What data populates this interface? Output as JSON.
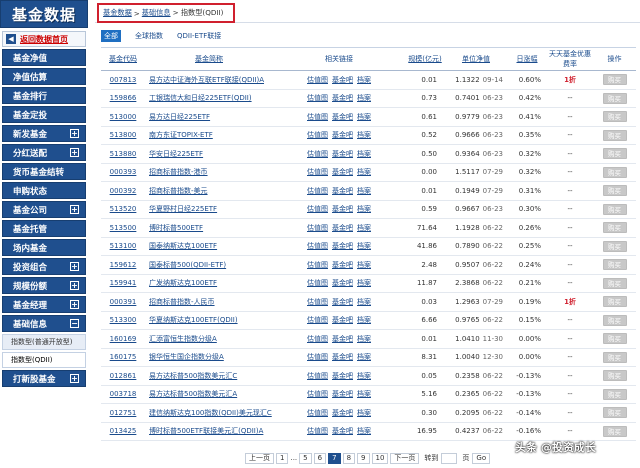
{
  "sidebar": {
    "logo": "基金数据",
    "back_home": "返回数据首页",
    "items": [
      {
        "label": "基金净值",
        "pm": ""
      },
      {
        "label": "净值估算",
        "pm": ""
      },
      {
        "label": "基金排行",
        "pm": ""
      },
      {
        "label": "基金定投",
        "pm": ""
      },
      {
        "label": "新发基金",
        "pm": "+"
      },
      {
        "label": "分红送配",
        "pm": "+"
      },
      {
        "label": "货币基金结转",
        "pm": ""
      },
      {
        "label": "申购状态",
        "pm": ""
      },
      {
        "label": "基金公司",
        "pm": "+"
      },
      {
        "label": "基金托管",
        "pm": ""
      },
      {
        "label": "场内基金",
        "pm": ""
      },
      {
        "label": "投资组合",
        "pm": "+"
      },
      {
        "label": "规模份额",
        "pm": "+"
      },
      {
        "label": "基金经理",
        "pm": "+"
      },
      {
        "label": "基础信息",
        "pm": "−"
      }
    ],
    "sub_items": [
      "指数型(普通开放型)",
      "指数型(QDII)"
    ],
    "last_item": {
      "label": "打新股基金",
      "pm": "+"
    }
  },
  "breadcrumb": {
    "link1": "基金数据",
    "sep": ">",
    "link2": "基础信息",
    "current": "> 指数型(QDII)"
  },
  "filter_tabs": [
    "全部",
    "全球指数",
    "QDII-ETF联接"
  ],
  "table": {
    "headers": [
      "基金代码",
      "基金简称",
      "相关链接",
      "规模(亿元)",
      "单位净值",
      "日涨幅",
      "天天基金优惠费率",
      "操作"
    ],
    "link_labels": [
      "估值图",
      "基金吧",
      "档案"
    ],
    "buy_label": "购买",
    "rows": [
      {
        "code": "007813",
        "name": "易方达中证海外互联ETF联接(QDII)A",
        "scale": "0.01",
        "nav": "1.1322",
        "date": "09-14",
        "change": "0.60%",
        "discount": "1折"
      },
      {
        "code": "159866",
        "name": "工银瑞信大和日经225ETF(QDII)",
        "scale": "0.73",
        "nav": "0.7401",
        "date": "06-23",
        "change": "0.42%",
        "discount": "--"
      },
      {
        "code": "513000",
        "name": "易方达日经225ETF",
        "scale": "0.61",
        "nav": "0.9779",
        "date": "06-23",
        "change": "0.41%",
        "discount": "--"
      },
      {
        "code": "513800",
        "name": "南方东证TOPIX-ETF",
        "scale": "0.52",
        "nav": "0.9666",
        "date": "06-23",
        "change": "0.35%",
        "discount": "--"
      },
      {
        "code": "513880",
        "name": "华安日经225ETF",
        "scale": "0.50",
        "nav": "0.9364",
        "date": "06-23",
        "change": "0.32%",
        "discount": "--"
      },
      {
        "code": "000393",
        "name": "招商标普指数-港币",
        "scale": "0.00",
        "nav": "1.5117",
        "date": "07-29",
        "change": "0.32%",
        "discount": "--"
      },
      {
        "code": "000392",
        "name": "招商标普指数-美元",
        "scale": "0.01",
        "nav": "0.1949",
        "date": "07-29",
        "change": "0.31%",
        "discount": "--"
      },
      {
        "code": "513520",
        "name": "华夏野村日经225ETF",
        "scale": "0.59",
        "nav": "0.9667",
        "date": "06-23",
        "change": "0.30%",
        "discount": "--"
      },
      {
        "code": "513500",
        "name": "博时标普500ETF",
        "scale": "71.64",
        "nav": "1.1928",
        "date": "06-22",
        "change": "0.26%",
        "discount": "--"
      },
      {
        "code": "513100",
        "name": "国泰纳斯达克100ETF",
        "scale": "41.86",
        "nav": "0.7890",
        "date": "06-22",
        "change": "0.25%",
        "discount": "--"
      },
      {
        "code": "159612",
        "name": "国泰标普500(QDII-ETF)",
        "scale": "2.48",
        "nav": "0.9507",
        "date": "06-22",
        "change": "0.24%",
        "discount": "--"
      },
      {
        "code": "159941",
        "name": "广发纳斯达克100ETF",
        "scale": "11.87",
        "nav": "2.3868",
        "date": "06-22",
        "change": "0.21%",
        "discount": "--"
      },
      {
        "code": "000391",
        "name": "招商标普指数-人民币",
        "scale": "0.03",
        "nav": "1.2963",
        "date": "07-29",
        "change": "0.19%",
        "discount": "1折"
      },
      {
        "code": "513300",
        "name": "华夏纳斯达克100ETF(QDII)",
        "scale": "6.66",
        "nav": "0.9765",
        "date": "06-22",
        "change": "0.15%",
        "discount": "--"
      },
      {
        "code": "160169",
        "name": "汇添富恒生指数分级A",
        "scale": "0.01",
        "nav": "1.0410",
        "date": "11-30",
        "change": "0.00%",
        "discount": "--"
      },
      {
        "code": "160175",
        "name": "银华恒生国企指数分级A",
        "scale": "8.31",
        "nav": "1.0040",
        "date": "12-30",
        "change": "0.00%",
        "discount": "--"
      },
      {
        "code": "012861",
        "name": "易方达标普500指数美元汇C",
        "scale": "0.05",
        "nav": "0.2358",
        "date": "06-22",
        "change": "-0.13%",
        "discount": "--"
      },
      {
        "code": "003718",
        "name": "易方达标普500指数美元汇A",
        "scale": "5.16",
        "nav": "0.2365",
        "date": "06-22",
        "change": "-0.13%",
        "discount": "--"
      },
      {
        "code": "012751",
        "name": "建信纳斯达克100指数(QDII)美元现汇C",
        "scale": "0.30",
        "nav": "0.2095",
        "date": "06-22",
        "change": "-0.14%",
        "discount": "--"
      },
      {
        "code": "013425",
        "name": "博时标普500ETF联接美元汇(QDII)A",
        "scale": "16.95",
        "nav": "0.4237",
        "date": "06-22",
        "change": "-0.16%",
        "discount": "--"
      }
    ]
  },
  "pager": {
    "prev": "上一页",
    "first": "1",
    "dots": "...",
    "pages": [
      "5",
      "6",
      "7",
      "8",
      "9",
      "10"
    ],
    "active": "7",
    "next": "下一页",
    "goto_label": "转到",
    "page_unit": "页",
    "go": "Go"
  },
  "watermark": "头条 @投资成长"
}
